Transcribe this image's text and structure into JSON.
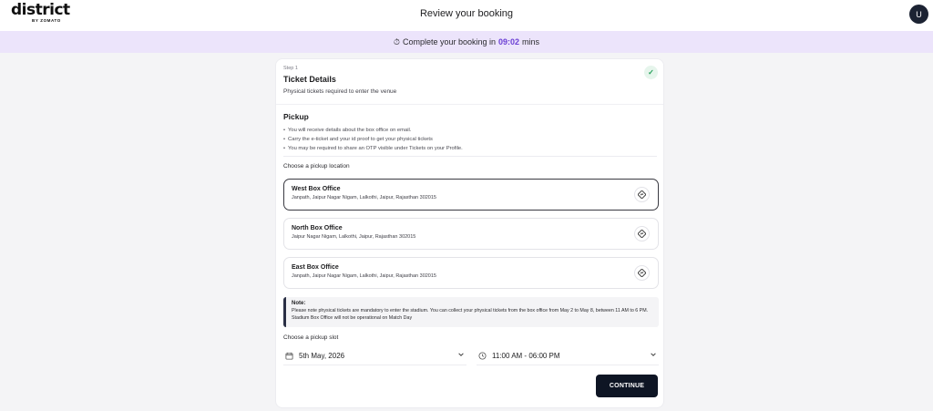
{
  "header": {
    "logo_text": "district",
    "logo_sub": "BY ZOMATO",
    "title": "Review your booking",
    "avatar_initial": "U"
  },
  "timer": {
    "prefix": "Complete your booking in",
    "time": "09:02",
    "suffix": "mins"
  },
  "step": {
    "label": "Step 1",
    "title": "Ticket Details",
    "subtitle": "Physical tickets required to enter the venue"
  },
  "pickup": {
    "title": "Pickup",
    "bullets": [
      "You will receive details about the box office on email.",
      "Carry the e-ticket and your id proof to get your physical tickets",
      "You may be required to share an OTP visible under Tickets on your Profile."
    ],
    "choose_location_label": "Choose a pickup location",
    "locations": [
      {
        "name": "West Box Office",
        "address": "Janpath, Jaipur Nagar Nigam, Lalkothi, Jaipur, Rajasthan 302015",
        "selected": true
      },
      {
        "name": "North Box Office",
        "address": "Jaipur Nagar Nigam, Lalkothi, Jaipur, Rajasthan 302015",
        "selected": false
      },
      {
        "name": "East Box Office",
        "address": "Janpath, Jaipur Nagar Nigam, Lalkothi, Jaipur, Rajasthan 302015",
        "selected": false
      }
    ]
  },
  "note": {
    "title": "Note:",
    "body": "Please note physical tickets are mandatory to enter the stadium. You can collect your physical tickets from the box office from May 2 to May 8, between 11 AM to 6 PM. Stadium Box Office will not be operational on Match Day"
  },
  "slot": {
    "label": "Choose a pickup slot",
    "date_value": "5th May, 2026",
    "time_value": "11:00 AM - 06:00 PM"
  },
  "actions": {
    "continue_label": "CONTINUE"
  },
  "colors": {
    "timer_bg": "#ece4fb",
    "timer_accent": "#6b3fd4",
    "primary_button": "#0e1524",
    "success": "#1f9d55"
  },
  "icons": {
    "timer": "stopwatch-icon",
    "check": "check-icon",
    "directions": "directions-icon",
    "calendar": "calendar-icon",
    "clock": "clock-icon",
    "chevron": "chevron-down-icon"
  }
}
